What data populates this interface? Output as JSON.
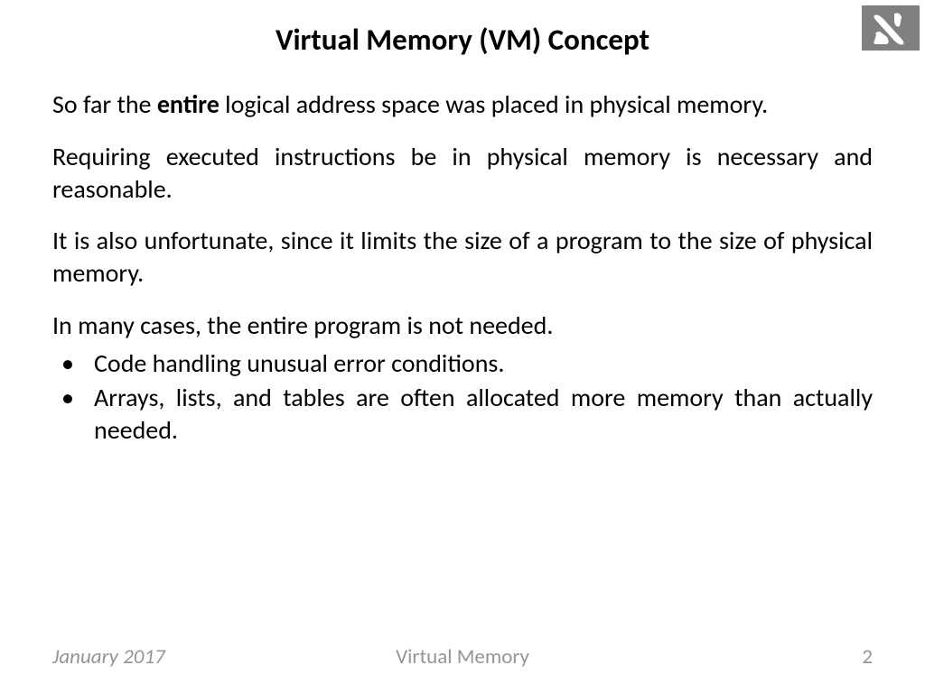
{
  "slide": {
    "title": "Virtual Memory (VM) Concept",
    "para1_a": "So far the ",
    "para1_b": "entire",
    "para1_c": " logical address space was placed in physical memory.",
    "para2": "Requiring executed instructions be in physical memory is necessary and reasonable.",
    "para3": "It is also unfortunate, since it limits the size of a program to the size of physical memory.",
    "para4": "In many cases, the entire program is not needed.",
    "bullets": [
      "Code handling unusual error conditions.",
      "Arrays, lists, and tables are often allocated more memory than actually needed."
    ]
  },
  "footer": {
    "date": "January 2017",
    "topic": "Virtual Memory",
    "page": "2"
  }
}
